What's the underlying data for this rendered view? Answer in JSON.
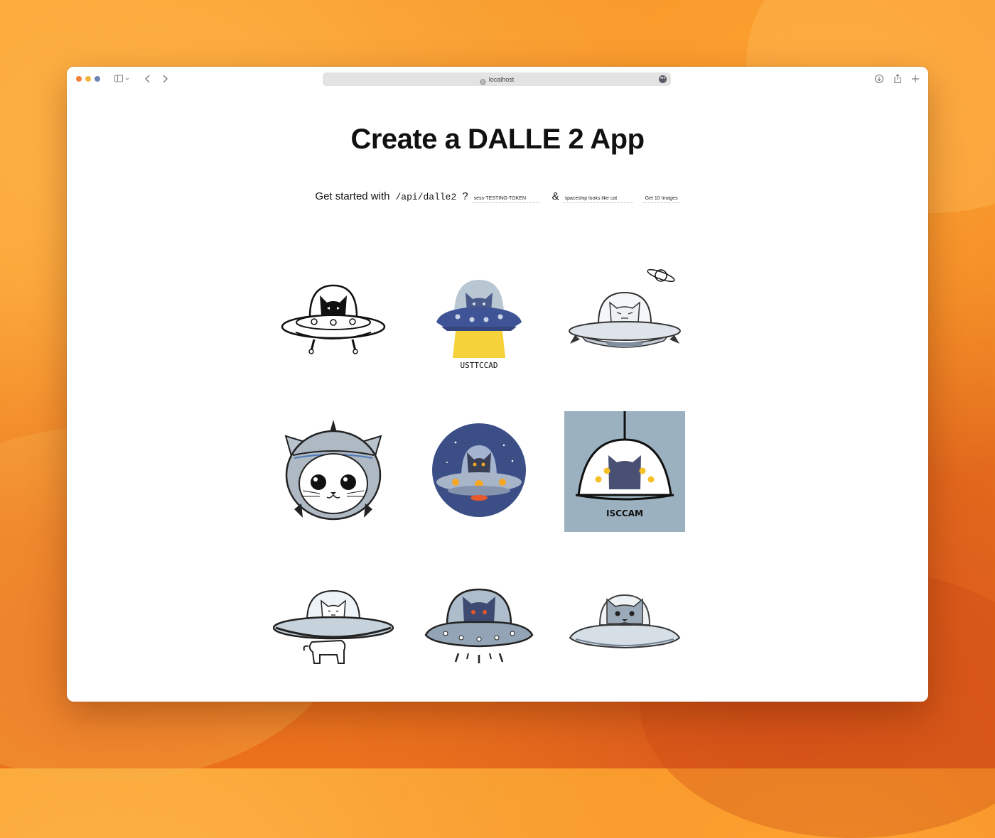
{
  "browser": {
    "url": "localhost",
    "traffic_colors": [
      "#f0823c",
      "#f5b43c",
      "#6e84b5"
    ]
  },
  "page": {
    "title": "Create a DALLE 2 App",
    "form": {
      "intro": "Get started with",
      "endpoint": "/api/dalle2",
      "query_sep": "?",
      "token_value": "sess-TESTING-TOKEN",
      "amp_sep": "&",
      "prompt_value": "spaceship looks like cat",
      "button_label": "Get 10 Images"
    }
  },
  "gallery": {
    "images": [
      {
        "subject": "cat-ufo-outline-black-cat",
        "caption": ""
      },
      {
        "subject": "cat-ufo-blue-tractor-beam",
        "caption": "USTTCCAD"
      },
      {
        "subject": "cat-ufo-with-planet",
        "caption": ""
      },
      {
        "subject": "cat-head-helmet",
        "caption": ""
      },
      {
        "subject": "cat-ufo-round-space-badge",
        "caption": ""
      },
      {
        "subject": "cat-ufo-gray-poster",
        "caption": "ISCCAM"
      },
      {
        "subject": "cat-ufo-white-cat-legs",
        "caption": ""
      },
      {
        "subject": "cat-ufo-orange-eyes",
        "caption": ""
      },
      {
        "subject": "cat-ufo-gray-cat",
        "caption": ""
      }
    ]
  }
}
